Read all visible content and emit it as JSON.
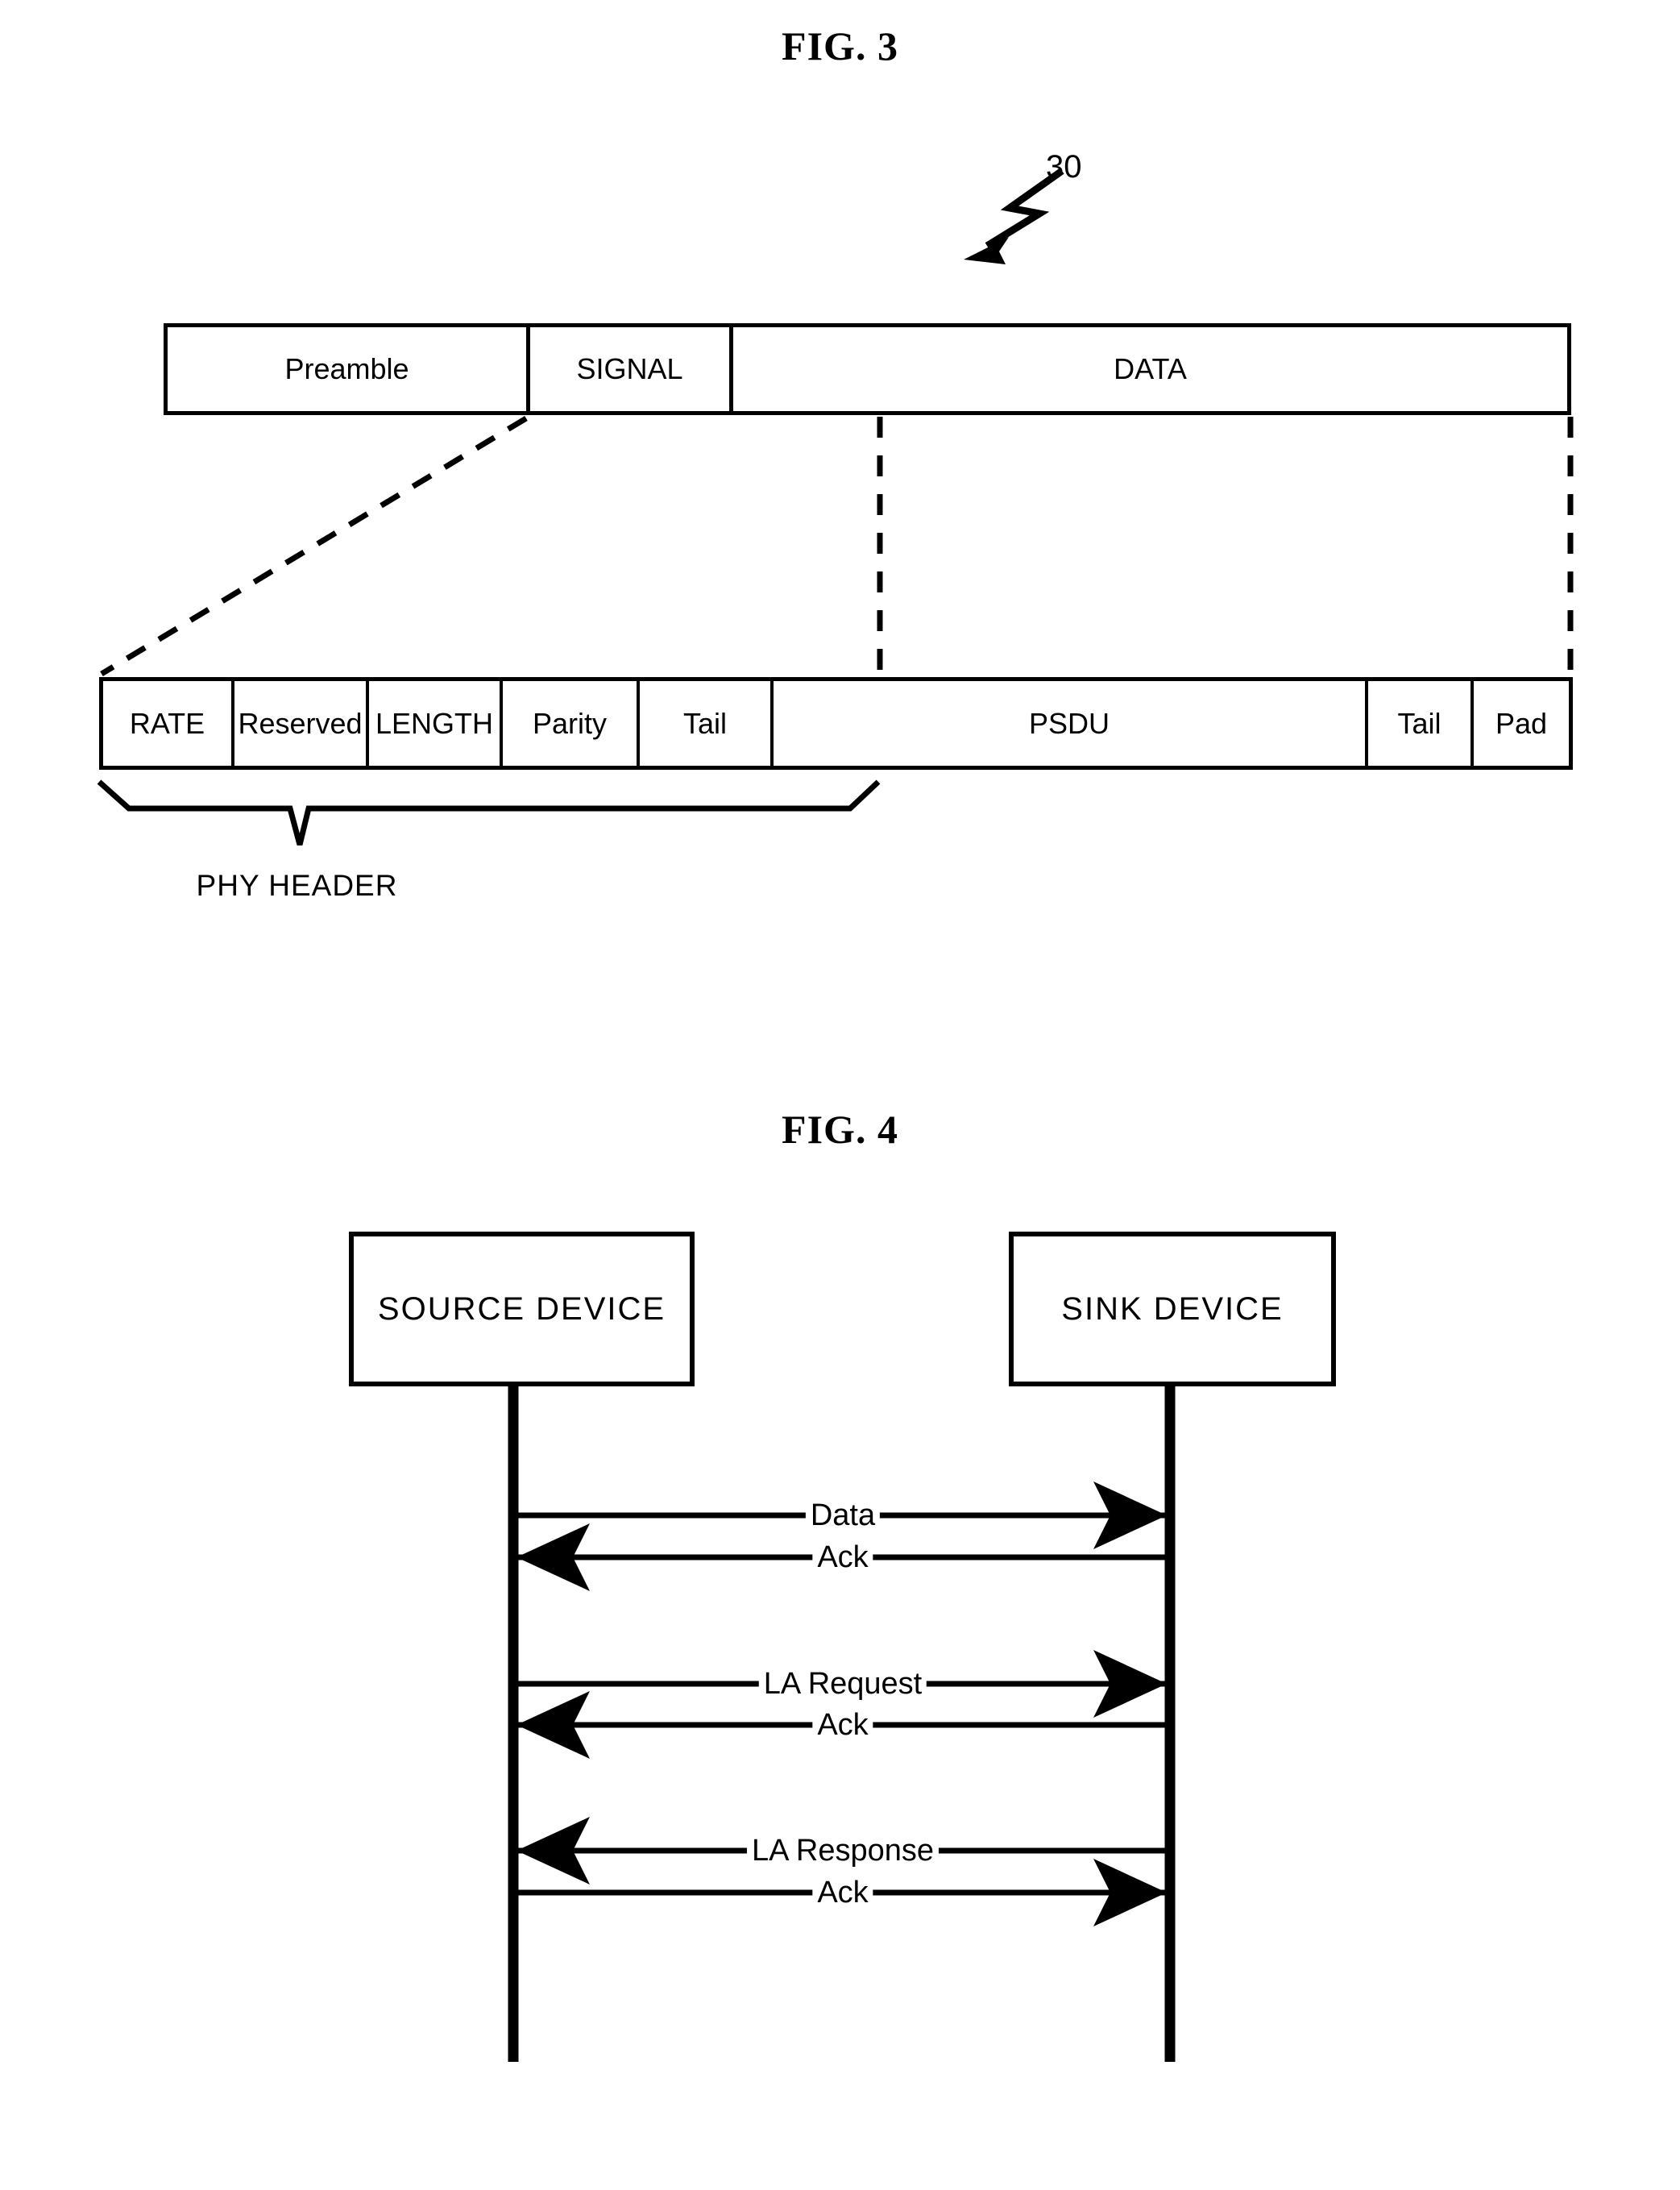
{
  "figures": {
    "fig3": {
      "title": "FIG. 3",
      "reference_numeral": "30",
      "frame_cells": [
        {
          "label": "Preamble"
        },
        {
          "label": "SIGNAL"
        },
        {
          "label": "DATA"
        }
      ],
      "detail_cells": [
        {
          "label": "RATE"
        },
        {
          "label": "Reserved"
        },
        {
          "label": "LENGTH"
        },
        {
          "label": "Parity"
        },
        {
          "label": "Tail"
        },
        {
          "label": "PSDU"
        },
        {
          "label": "Tail"
        },
        {
          "label": "Pad"
        }
      ],
      "brace_label": "PHY HEADER"
    },
    "fig4": {
      "title": "FIG. 4",
      "lifelines": [
        {
          "label": "SOURCE  DEVICE"
        },
        {
          "label": "SINK  DEVICE"
        }
      ],
      "messages": [
        {
          "label": "Data",
          "direction": "right"
        },
        {
          "label": "Ack",
          "direction": "left"
        },
        {
          "label": "LA Request",
          "direction": "right"
        },
        {
          "label": "Ack",
          "direction": "left"
        },
        {
          "label": "LA Response",
          "direction": "left"
        },
        {
          "label": "Ack",
          "direction": "right"
        }
      ]
    }
  },
  "colors": {
    "ink": "#000000",
    "paper": "#ffffff"
  }
}
